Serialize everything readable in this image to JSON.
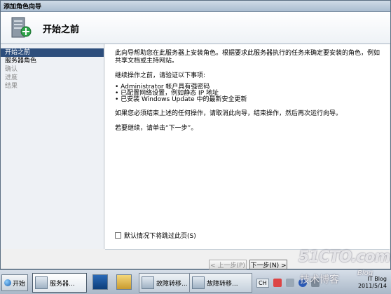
{
  "window": {
    "title": "添加角色向导"
  },
  "header": {
    "title": "开始之前",
    "icon": "server-role-add-icon"
  },
  "nav": {
    "items": [
      {
        "label": "开始之前",
        "state": "active"
      },
      {
        "label": "服务器角色",
        "state": "normal"
      },
      {
        "label": "确认",
        "state": "disabled"
      },
      {
        "label": "进度",
        "state": "disabled"
      },
      {
        "label": "结果",
        "state": "disabled"
      }
    ]
  },
  "content": {
    "intro": "此向导帮助您在此服务器上安装角色。根据要求此服务器执行的任务来确定要安装的角色，例如共享文档或主持网站。",
    "verify_heading": "继续操作之前，请验证以下事项:",
    "bullets": [
      "Administrator 帐户具有强密码",
      "已配置网络设置，例如静态 IP 地址",
      "已安装 Windows Update 中的最新安全更新"
    ],
    "cancel_note": "如果您必须结束上述的任何操作，请取消此向导，结束操作，然后再次运行向导。",
    "continue_note": "若要继续，请单击“下一步”。",
    "skip_checkbox_label": "默认情况下将跳过此页(S)",
    "skip_checked": false
  },
  "footer": {
    "prev_label": "< 上一步(P)",
    "next_label": "下一步(N) >"
  },
  "taskbar": {
    "start_label": "开始",
    "buttons": [
      {
        "label": "服务器...",
        "active": true
      },
      {
        "label": "故障转移...",
        "active": false
      },
      {
        "label": "故障转移...",
        "active": false
      }
    ],
    "lang": "CH",
    "clock_time": "IT Blog",
    "clock_date": "2011/5/14"
  },
  "watermark": {
    "site": "51CTO.com",
    "sub": "技术博客",
    "blog": "Blog"
  },
  "colors": {
    "nav_active_bg": "#2d4e7c",
    "titlebar": "#aabdd0"
  }
}
